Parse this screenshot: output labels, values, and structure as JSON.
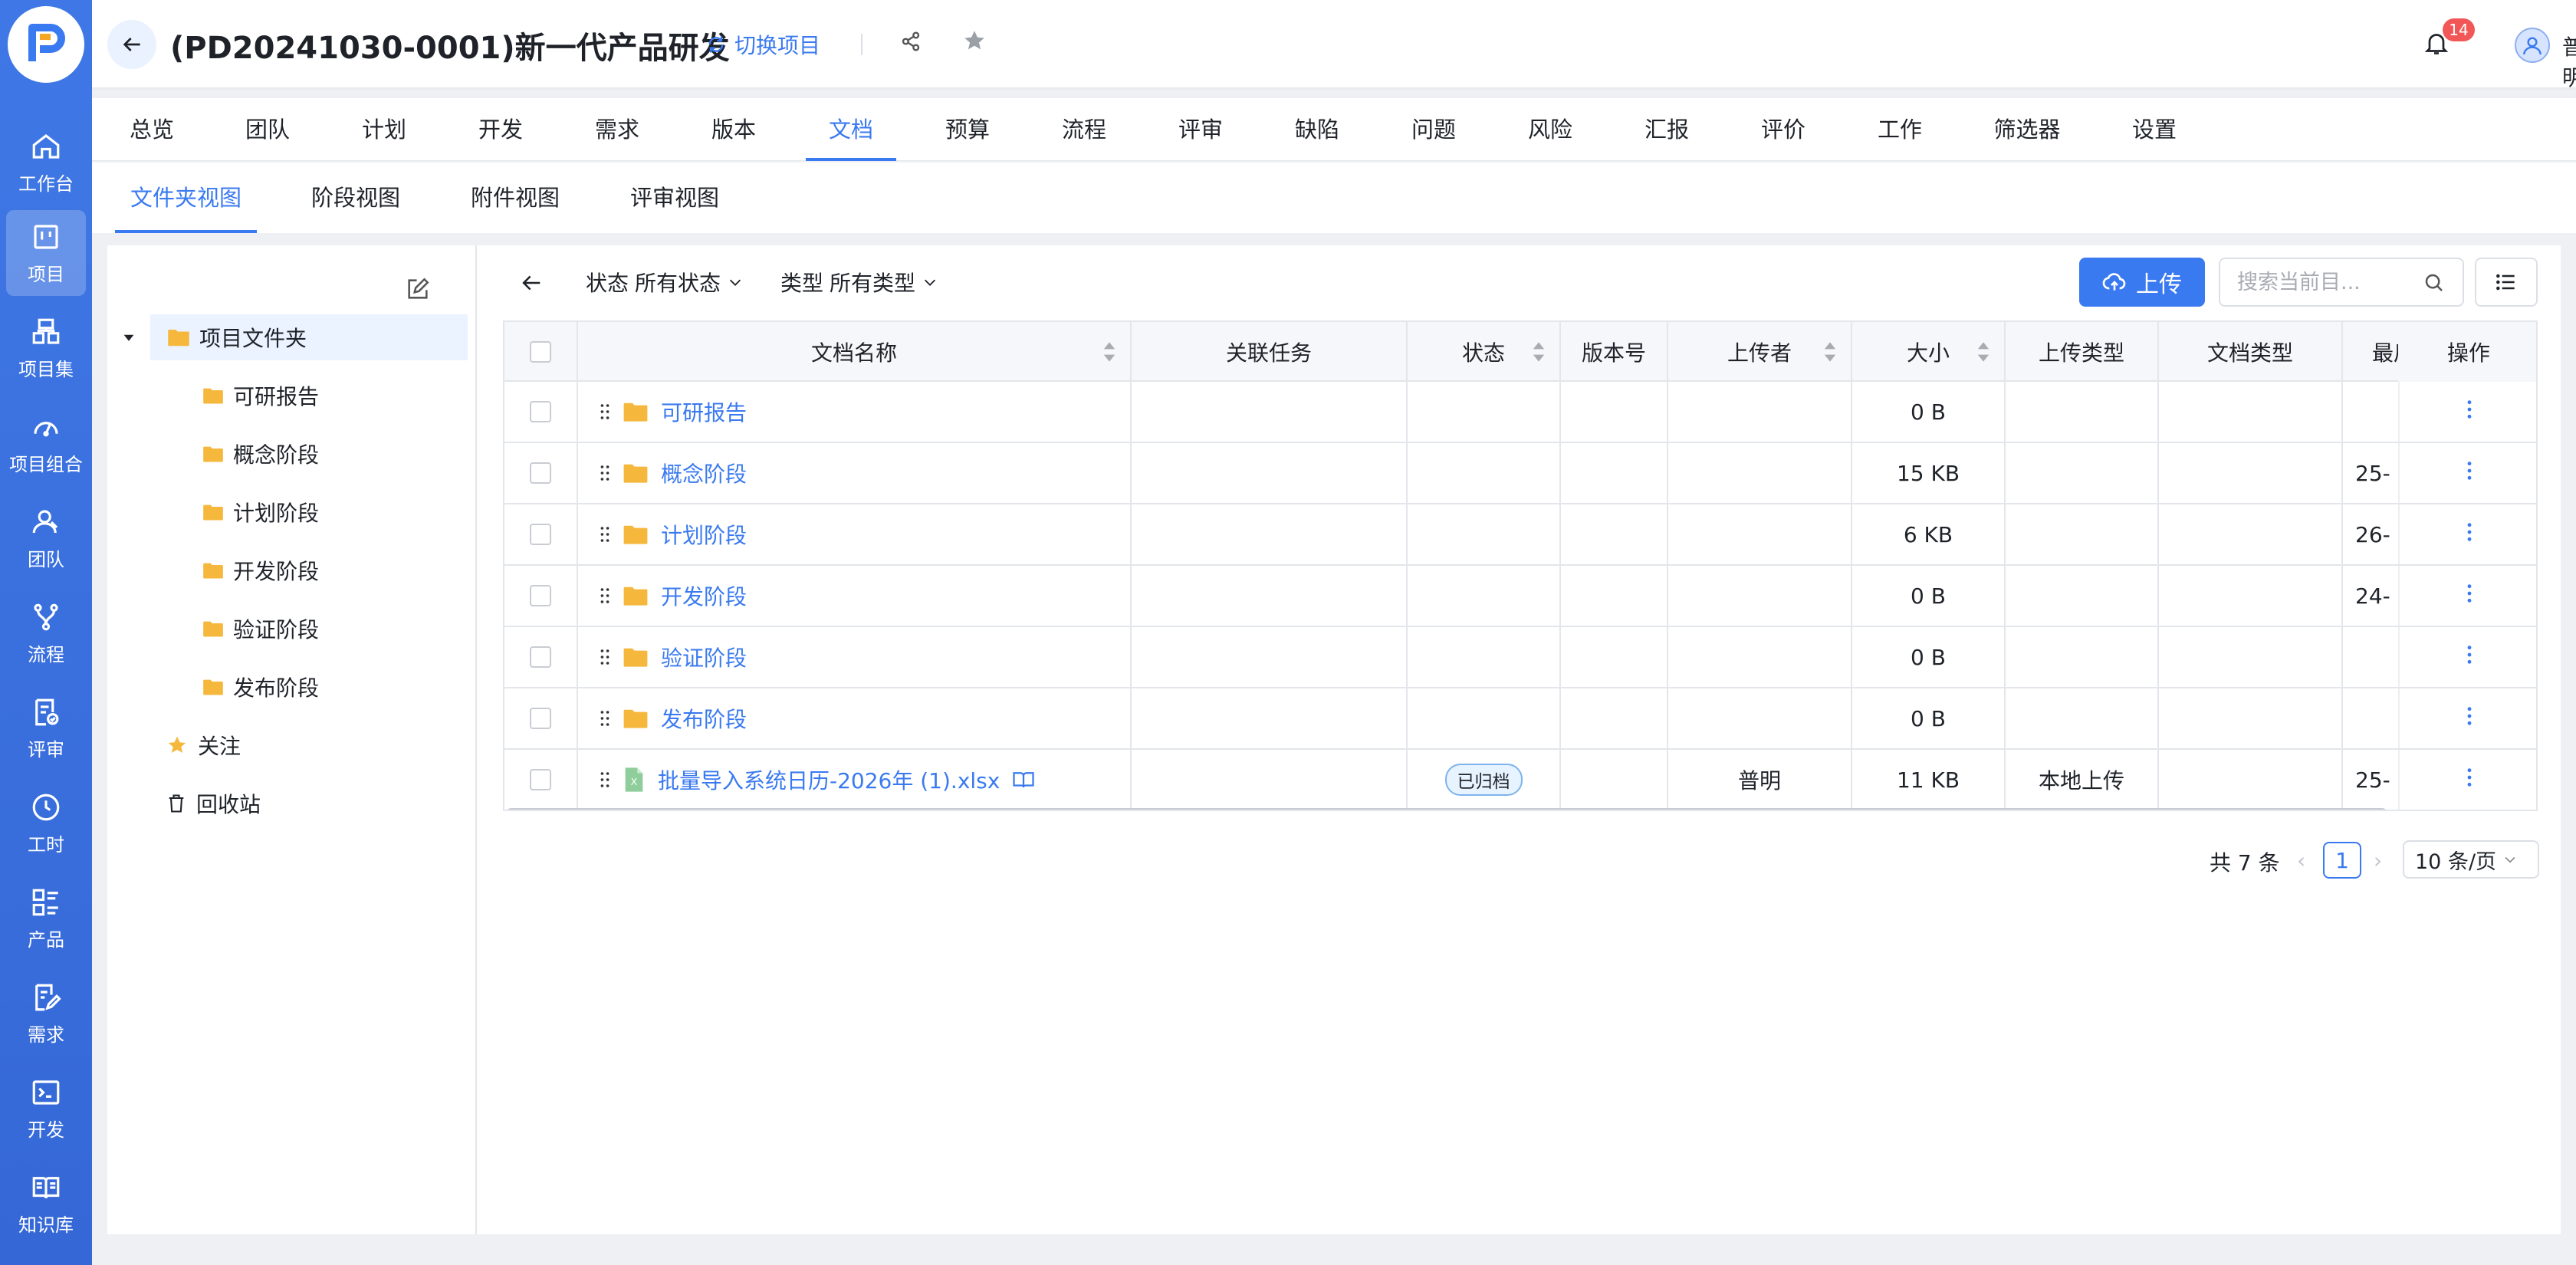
{
  "header": {
    "project_title": "(PD20241030-0001)新一代产品研发",
    "switch_project": "切换项目",
    "notification_count": "14",
    "user_name": "普明"
  },
  "rail": {
    "items": [
      {
        "label": "工作台",
        "icon": "home-icon"
      },
      {
        "label": "项目",
        "icon": "project-icon"
      },
      {
        "label": "项目集",
        "icon": "project-set-icon"
      },
      {
        "label": "项目组合",
        "icon": "portfolio-icon"
      },
      {
        "label": "团队",
        "icon": "team-icon"
      },
      {
        "label": "流程",
        "icon": "flow-icon"
      },
      {
        "label": "评审",
        "icon": "review-icon"
      },
      {
        "label": "工时",
        "icon": "clock-icon"
      },
      {
        "label": "产品",
        "icon": "product-icon"
      },
      {
        "label": "需求",
        "icon": "requirement-icon"
      },
      {
        "label": "开发",
        "icon": "terminal-icon"
      },
      {
        "label": "知识库",
        "icon": "book-icon"
      }
    ]
  },
  "main_tabs": [
    "总览",
    "团队",
    "计划",
    "开发",
    "需求",
    "版本",
    "文档",
    "预算",
    "流程",
    "评审",
    "缺陷",
    "问题",
    "风险",
    "汇报",
    "评价",
    "工作",
    "筛选器",
    "设置"
  ],
  "sub_tabs": [
    "文件夹视图",
    "阶段视图",
    "附件视图",
    "评审视图"
  ],
  "tree": {
    "root": "项目文件夹",
    "children": [
      "可研报告",
      "概念阶段",
      "计划阶段",
      "开发阶段",
      "验证阶段",
      "发布阶段"
    ],
    "follow": "关注",
    "recycle": "回收站"
  },
  "toolbar": {
    "status_label": "状态",
    "status_value": "所有状态",
    "type_label": "类型",
    "type_value": "所有类型",
    "upload": "上传",
    "search_placeholder": "搜索当前目..."
  },
  "table": {
    "columns": [
      "文档名称",
      "关联任务",
      "状态",
      "版本号",
      "上传者",
      "大小",
      "上传类型",
      "文档类型",
      "最后",
      "操作"
    ],
    "rows": [
      {
        "name": "可研报告",
        "type": "folder",
        "task": "",
        "status": "",
        "version": "",
        "uploader": "",
        "size": "0 B",
        "upload_type": "",
        "doc_type": "",
        "last": ""
      },
      {
        "name": "概念阶段",
        "type": "folder",
        "task": "",
        "status": "",
        "version": "",
        "uploader": "",
        "size": "15 KB",
        "upload_type": "",
        "doc_type": "",
        "last": "25-"
      },
      {
        "name": "计划阶段",
        "type": "folder",
        "task": "",
        "status": "",
        "version": "",
        "uploader": "",
        "size": "6 KB",
        "upload_type": "",
        "doc_type": "",
        "last": "26-"
      },
      {
        "name": "开发阶段",
        "type": "folder",
        "task": "",
        "status": "",
        "version": "",
        "uploader": "",
        "size": "0 B",
        "upload_type": "",
        "doc_type": "",
        "last": "24-"
      },
      {
        "name": "验证阶段",
        "type": "folder",
        "task": "",
        "status": "",
        "version": "",
        "uploader": "",
        "size": "0 B",
        "upload_type": "",
        "doc_type": "",
        "last": ""
      },
      {
        "name": "发布阶段",
        "type": "folder",
        "task": "",
        "status": "",
        "version": "",
        "uploader": "",
        "size": "0 B",
        "upload_type": "",
        "doc_type": "",
        "last": ""
      },
      {
        "name": "批量导入系统日历-2026年 (1).xlsx",
        "type": "excel",
        "task": "",
        "status": "已归档",
        "version": "",
        "uploader": "普明",
        "size": "11 KB",
        "upload_type": "本地上传",
        "doc_type": "",
        "last": "25-"
      }
    ]
  },
  "pagination": {
    "total": "共 7 条",
    "page": "1",
    "page_size": "10 条/页"
  },
  "colors": {
    "accent": "#3a7af0",
    "rail": "#3568d6",
    "folder": "#f5b83d",
    "badge": "#f25757"
  }
}
